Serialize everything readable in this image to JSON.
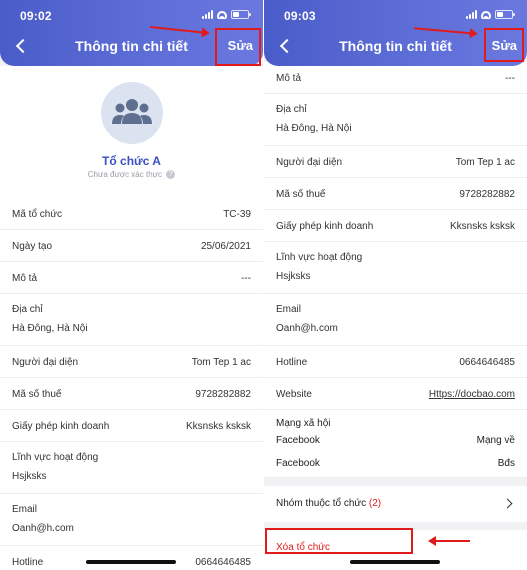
{
  "colors": {
    "accent": "#4a5cc9",
    "danger": "#e11b1b",
    "link": "#2f5bd6",
    "org_name": "#3c4fc2"
  },
  "left": {
    "status": {
      "time": "09:02"
    },
    "header": {
      "title": "Thông tin chi tiết",
      "edit_label": "Sửa",
      "back_icon": "chevron-left-icon"
    },
    "profile": {
      "avatar_icon": "group-icon",
      "name": "Tổ chức A",
      "verify_status": "Chưa được xác thực",
      "help_icon": "?"
    },
    "rows": [
      {
        "label": "Mã tổ chức",
        "value": "TC-39"
      },
      {
        "label": "Ngày tạo",
        "value": "25/06/2021"
      },
      {
        "label": "Mô tả",
        "value": "---"
      },
      {
        "label": "Địa chỉ",
        "value": "Hà Đông, Hà Nội"
      },
      {
        "label": "Người đại diện",
        "value": "Tom Tep 1 ac"
      },
      {
        "label": "Mã số thuế",
        "value": "9728282882"
      },
      {
        "label": "Giấy phép kinh doanh",
        "value": "Kksnsks ksksk"
      },
      {
        "label": "Lĩnh vực hoạt động",
        "value": "Hsjksks"
      },
      {
        "label": "Email",
        "value": "Oanh@h.com"
      },
      {
        "label": "Hotline",
        "value": "0664646485"
      }
    ]
  },
  "right": {
    "status": {
      "time": "09:03"
    },
    "header": {
      "title": "Thông tin chi tiết",
      "edit_label": "Sửa",
      "back_icon": "chevron-left-icon"
    },
    "rows": [
      {
        "label": "Mô tả",
        "value": "---"
      },
      {
        "label": "Địa chỉ",
        "value": "Hà Đông, Hà Nội"
      },
      {
        "label": "Người đại diện",
        "value": "Tom Tep 1 ac"
      },
      {
        "label": "Mã số thuế",
        "value": "9728282882"
      },
      {
        "label": "Giấy phép kinh doanh",
        "value": "Kksnsks ksksk"
      },
      {
        "label": "Lĩnh vực hoạt động",
        "value": "Hsjksks"
      },
      {
        "label": "Email",
        "value": "Oanh@h.com"
      },
      {
        "label": "Hotline",
        "value": "0664646485"
      },
      {
        "label": "Website",
        "value": "Https://docbao.com"
      }
    ],
    "social": {
      "label": "Mạng xã hội",
      "items": [
        {
          "name": "Facebook",
          "value": "Mạng về"
        },
        {
          "name": "Facebook",
          "value": "Bđs"
        }
      ]
    },
    "group_row": {
      "label": "Nhóm thuộc tổ chức",
      "count": "(2)",
      "chevron_icon": "chevron-right-icon"
    },
    "delete_label": "Xóa tổ chức"
  }
}
